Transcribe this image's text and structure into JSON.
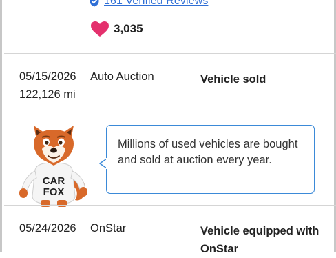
{
  "reviews": {
    "link_text": "161 Verified Reviews"
  },
  "likes": {
    "count": "3,035"
  },
  "records": [
    {
      "date": "05/15/2026",
      "source": "Auto Auction",
      "mileage": "122,126 mi",
      "event": "Vehicle sold"
    },
    {
      "date": "05/24/2026",
      "source": "OnStar",
      "event_line1": "Vehicle equipped with",
      "event_line2": "OnStar"
    }
  ],
  "tip": {
    "text": "Millions of used vehicles are bought and sold at auction every year."
  },
  "mascot": {
    "shirt_line1": "CAR",
    "shirt_line2": "FOX"
  },
  "colors": {
    "link": "#2f6fd6",
    "heart": "#e4306d",
    "tooltip_border": "#3b8ad8",
    "fox_orange": "#d8692a"
  }
}
